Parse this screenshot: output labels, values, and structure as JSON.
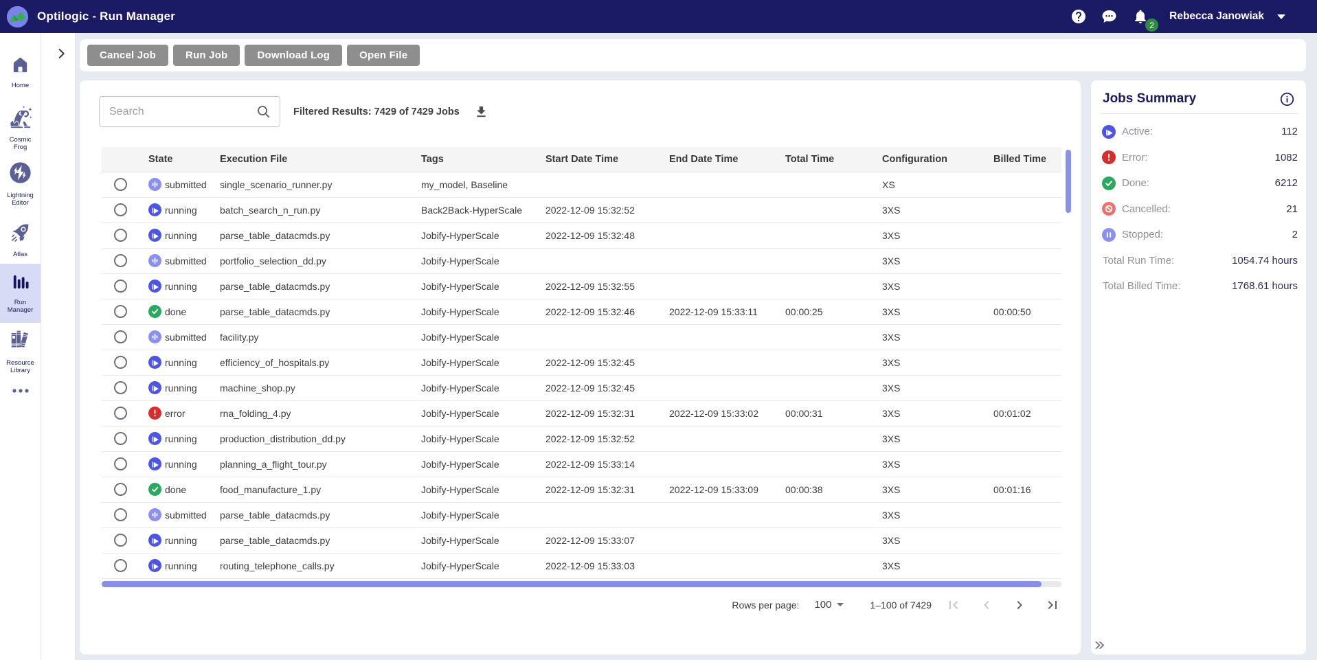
{
  "topbar": {
    "title": "Optilogic - Run Manager",
    "user_name": "Rebecca Janowiak",
    "notification_count": "2",
    "icons": [
      "optilogic-logo",
      "help-icon",
      "chat-icon",
      "bell-icon",
      "caret-down-icon"
    ]
  },
  "sidebar": {
    "items": [
      {
        "label": "Home",
        "icon": "home-icon",
        "selected": false
      },
      {
        "label": "Cosmic Frog",
        "icon": "frog-icon",
        "selected": false
      },
      {
        "label": "Lightning Editor",
        "icon": "lightning-icon",
        "selected": false
      },
      {
        "label": "Atlas",
        "icon": "rocket-icon",
        "selected": false
      },
      {
        "label": "Run Manager",
        "icon": "bar-chart-icon",
        "selected": true
      },
      {
        "label": "Resource Library",
        "icon": "books-icon",
        "selected": false
      }
    ],
    "more_icon": "ellipsis-icon"
  },
  "toolbar": {
    "buttons": [
      "Cancel Job",
      "Run Job",
      "Download Log",
      "Open File"
    ]
  },
  "search": {
    "placeholder": "Search",
    "value": "",
    "filtered_results": "Filtered Results: 7429 of 7429 Jobs"
  },
  "table": {
    "columns": [
      "State",
      "Execution File",
      "Tags",
      "Start Date Time",
      "End Date Time",
      "Total Time",
      "Configuration",
      "Billed Time"
    ],
    "rows": [
      {
        "state": "submitted",
        "file": "single_scenario_runner.py",
        "tags": "my_model, Baseline",
        "start": "",
        "end": "",
        "total": "",
        "config": "XS",
        "billed": ""
      },
      {
        "state": "running",
        "file": "batch_search_n_run.py",
        "tags": "Back2Back-HyperScale",
        "start": "2022-12-09 15:32:52",
        "end": "",
        "total": "",
        "config": "3XS",
        "billed": ""
      },
      {
        "state": "running",
        "file": "parse_table_datacmds.py",
        "tags": "Jobify-HyperScale",
        "start": "2022-12-09 15:32:48",
        "end": "",
        "total": "",
        "config": "3XS",
        "billed": ""
      },
      {
        "state": "submitted",
        "file": "portfolio_selection_dd.py",
        "tags": "Jobify-HyperScale",
        "start": "",
        "end": "",
        "total": "",
        "config": "3XS",
        "billed": ""
      },
      {
        "state": "running",
        "file": "parse_table_datacmds.py",
        "tags": "Jobify-HyperScale",
        "start": "2022-12-09 15:32:55",
        "end": "",
        "total": "",
        "config": "3XS",
        "billed": ""
      },
      {
        "state": "done",
        "file": "parse_table_datacmds.py",
        "tags": "Jobify-HyperScale",
        "start": "2022-12-09 15:32:46",
        "end": "2022-12-09 15:33:11",
        "total": "00:00:25",
        "config": "3XS",
        "billed": "00:00:50"
      },
      {
        "state": "submitted",
        "file": "facility.py",
        "tags": "Jobify-HyperScale",
        "start": "",
        "end": "",
        "total": "",
        "config": "3XS",
        "billed": ""
      },
      {
        "state": "running",
        "file": "efficiency_of_hospitals.py",
        "tags": "Jobify-HyperScale",
        "start": "2022-12-09 15:32:45",
        "end": "",
        "total": "",
        "config": "3XS",
        "billed": ""
      },
      {
        "state": "running",
        "file": "machine_shop.py",
        "tags": "Jobify-HyperScale",
        "start": "2022-12-09 15:32:45",
        "end": "",
        "total": "",
        "config": "3XS",
        "billed": ""
      },
      {
        "state": "error",
        "file": "rna_folding_4.py",
        "tags": "Jobify-HyperScale",
        "start": "2022-12-09 15:32:31",
        "end": "2022-12-09 15:33:02",
        "total": "00:00:31",
        "config": "3XS",
        "billed": "00:01:02"
      },
      {
        "state": "running",
        "file": "production_distribution_dd.py",
        "tags": "Jobify-HyperScale",
        "start": "2022-12-09 15:32:52",
        "end": "",
        "total": "",
        "config": "3XS",
        "billed": ""
      },
      {
        "state": "running",
        "file": "planning_a_flight_tour.py",
        "tags": "Jobify-HyperScale",
        "start": "2022-12-09 15:33:14",
        "end": "",
        "total": "",
        "config": "3XS",
        "billed": ""
      },
      {
        "state": "done",
        "file": "food_manufacture_1.py",
        "tags": "Jobify-HyperScale",
        "start": "2022-12-09 15:32:31",
        "end": "2022-12-09 15:33:09",
        "total": "00:00:38",
        "config": "3XS",
        "billed": "00:01:16"
      },
      {
        "state": "submitted",
        "file": "parse_table_datacmds.py",
        "tags": "Jobify-HyperScale",
        "start": "",
        "end": "",
        "total": "",
        "config": "3XS",
        "billed": ""
      },
      {
        "state": "running",
        "file": "parse_table_datacmds.py",
        "tags": "Jobify-HyperScale",
        "start": "2022-12-09 15:33:07",
        "end": "",
        "total": "",
        "config": "3XS",
        "billed": ""
      },
      {
        "state": "running",
        "file": "routing_telephone_calls.py",
        "tags": "Jobify-HyperScale",
        "start": "2022-12-09 15:33:03",
        "end": "",
        "total": "",
        "config": "3XS",
        "billed": ""
      }
    ]
  },
  "pagination": {
    "rows_per_page_label": "Rows per page:",
    "rows_per_page": "100",
    "range": "1–100 of 7429",
    "buttons": [
      "first-page",
      "previous-page",
      "next-page",
      "last-page"
    ],
    "first_enabled": false,
    "prev_enabled": false,
    "next_enabled": true,
    "last_enabled": true
  },
  "summary": {
    "title": "Jobs Summary",
    "info_icon": "info-icon",
    "stats": [
      {
        "icon": "running",
        "label": "Active:",
        "value": "112"
      },
      {
        "icon": "error",
        "label": "Error:",
        "value": "1082"
      },
      {
        "icon": "done",
        "label": "Done:",
        "value": "6212"
      },
      {
        "icon": "cancelled",
        "label": "Cancelled:",
        "value": "21"
      },
      {
        "icon": "stopped",
        "label": "Stopped:",
        "value": "2"
      },
      {
        "icon": "",
        "label": "Total Run Time:",
        "value": "1054.74 hours"
      },
      {
        "icon": "",
        "label": "Total Billed Time:",
        "value": "1768.61 hours"
      }
    ],
    "expand_icon": "double-chevron-right-icon"
  },
  "colors": {
    "topbar_bg": "#1b1b65",
    "accent_indigo": "#5058d8",
    "light_indigo": "#8b90ec",
    "green": "#2fa45c",
    "red": "#d22f2f",
    "salmon": "#ee7171",
    "badge_green": "#2e8b44",
    "selected_bg": "#d8dbf5",
    "page_bg": "#e8eaf2",
    "button_gray": "#8e8e8e",
    "scrollbar_thumb": "#888fe8"
  }
}
